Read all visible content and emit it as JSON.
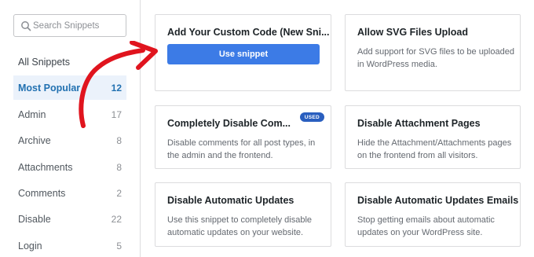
{
  "search": {
    "placeholder": "Search Snippets"
  },
  "categories": [
    {
      "label": "All Snippets",
      "count": ""
    },
    {
      "label": "Most Popular",
      "count": "12"
    },
    {
      "label": "Admin",
      "count": "17"
    },
    {
      "label": "Archive",
      "count": "8"
    },
    {
      "label": "Attachments",
      "count": "8"
    },
    {
      "label": "Comments",
      "count": "2"
    },
    {
      "label": "Disable",
      "count": "22"
    },
    {
      "label": "Login",
      "count": "5"
    }
  ],
  "cards": [
    {
      "title": "Add Your Custom Code (New Sni...",
      "button": "Use snippet"
    },
    {
      "title": "Allow SVG Files Upload",
      "desc_line1": "Add support for SVG files to be uploaded",
      "desc_line2": "in WordPress media."
    },
    {
      "title": "Completely Disable Com...",
      "badge": "USED",
      "desc_line1": "Disable comments for all post types, in",
      "desc_line2": "the admin and the frontend."
    },
    {
      "title": "Disable Attachment Pages",
      "desc_line1": "Hide the Attachment/Attachments pages",
      "desc_line2": "on the frontend from all visitors."
    },
    {
      "title": "Disable Automatic Updates",
      "desc_line1": "Use this snippet to completely disable",
      "desc_line2": "automatic updates on your website."
    },
    {
      "title": "Disable Automatic Updates Emails",
      "desc_line1": "Stop getting emails about automatic",
      "desc_line2": "updates on your WordPress site."
    }
  ],
  "colors": {
    "accent": "#2271b1",
    "active_bg": "#ebf2fb",
    "button": "#3c7be6",
    "badge": "#2a5fbf",
    "annotation_arrow": "#e0141e"
  }
}
